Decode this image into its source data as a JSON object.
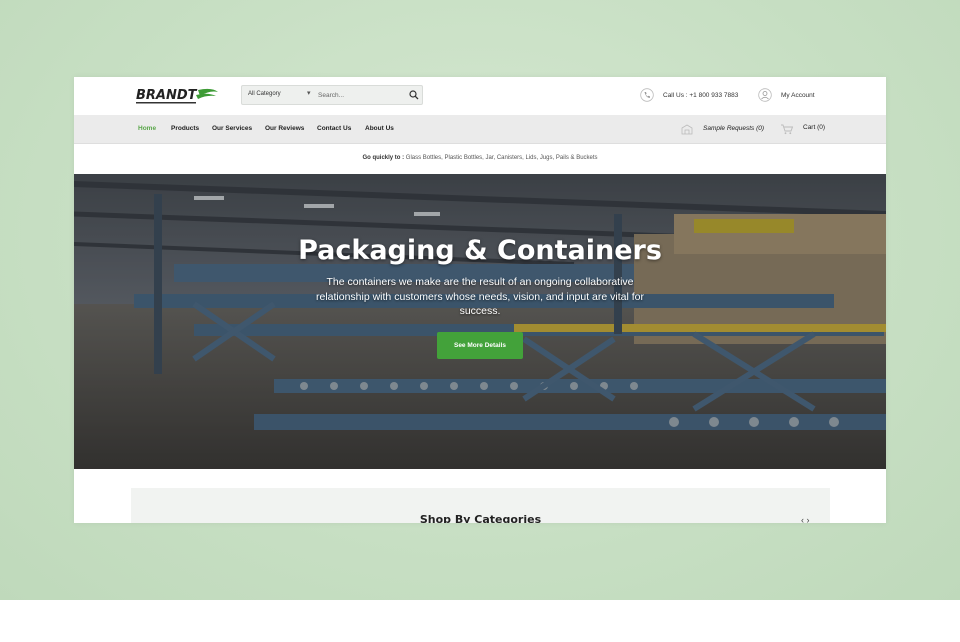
{
  "header": {
    "logo_text": "BRANDT",
    "search": {
      "category": "All Category",
      "placeholder": "Search..."
    },
    "call_label": "Call Us : +1 800 933 7883",
    "account_label": "My Account"
  },
  "nav": {
    "items": [
      {
        "label": "Home",
        "active": true
      },
      {
        "label": "Products"
      },
      {
        "label": "Our Services"
      },
      {
        "label": "Our Reviews"
      },
      {
        "label": "Contact Us"
      },
      {
        "label": "About Us"
      }
    ],
    "sample_requests": "Sample Requests (0)",
    "cart": "Cart (0)"
  },
  "quick_links": {
    "label": "Go quickly to :",
    "links": "Glass Bottles, Plastic Bottles, Jar, Canisters, Lids, Jugs, Pails & Buckets"
  },
  "hero": {
    "title": "Packaging & Containers",
    "text": "The containers we make are the result of an ongoing collaborative relationship with customers whose needs, vision, and input are vital for success.",
    "button_label": "See More Details"
  },
  "categories": {
    "title": "Shop By Categories",
    "arrows": "‹ ›"
  },
  "colors": {
    "accent_green": "#43a23a",
    "active_nav": "#5aa64a",
    "backdrop": "#c7dfc3"
  },
  "icons": [
    "logo-swoosh-icon",
    "chevron-down-icon",
    "search-icon",
    "phone-icon",
    "user-icon",
    "sample-request-icon",
    "cart-icon",
    "carousel-arrows-icon"
  ]
}
